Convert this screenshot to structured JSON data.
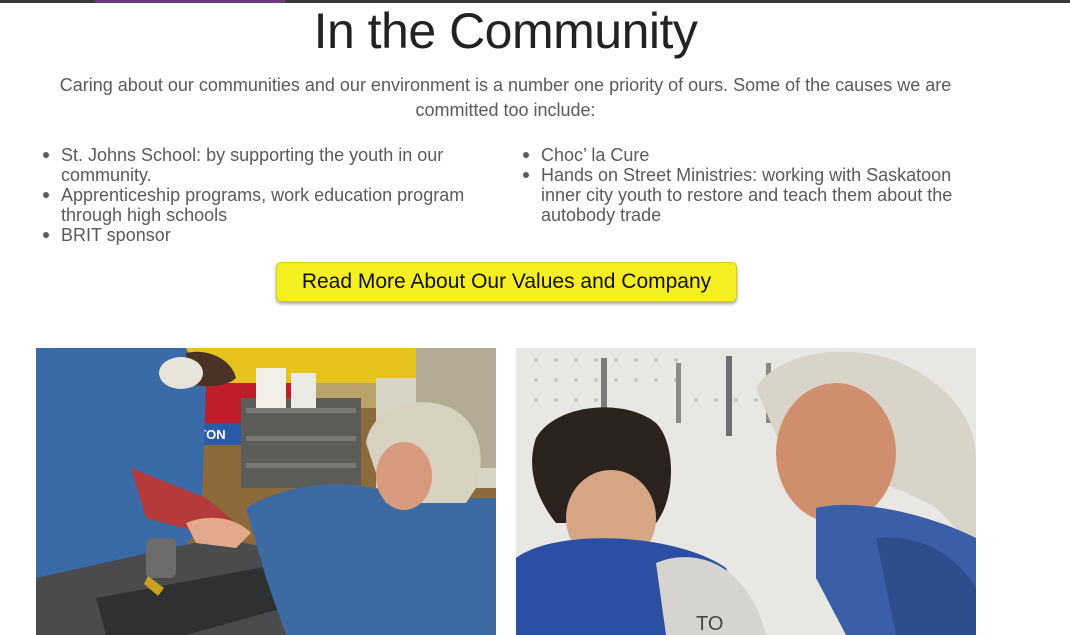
{
  "section": {
    "title": "In the Community",
    "intro": "Caring about our communities and our environment is a number one priority of ours. Some of the causes we are committed too include:"
  },
  "causes_left": [
    "St. Johns School: by supporting the youth in our community.",
    "Apprenticeship programs, work education program through high schools",
    "BRIT sponsor"
  ],
  "causes_right": [
    "Choc’ la Cure",
    "Hands on Street Ministries: working with Saskatoon inner city youth to restore and teach them about the autobody trade"
  ],
  "cta": {
    "label": "Read More About Our Values and Company"
  },
  "photos": {
    "left_sign_text": "RTON",
    "right_shirt_text": "TO"
  },
  "colors": {
    "cta_bg": "#f5ee20",
    "accent": "#6b3a78",
    "text": "#5a5a5a"
  }
}
